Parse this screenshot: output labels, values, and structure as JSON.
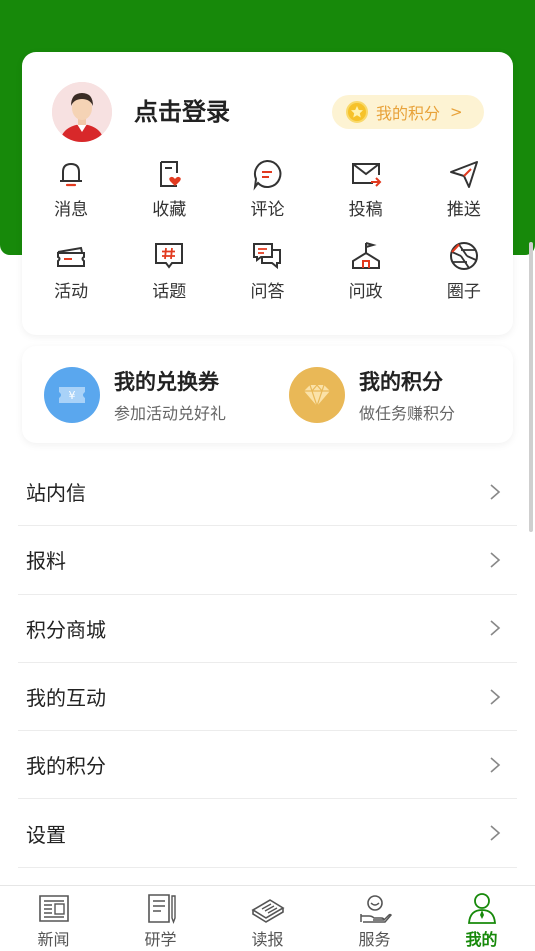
{
  "colors": {
    "brand_green": "#17890a",
    "accent_red": "#e23a1f",
    "gold": "#e8a23a"
  },
  "profile": {
    "login_text": "点击登录",
    "points_pill_label": "我的积分",
    "points_pill_arrow": ">"
  },
  "quick_actions": [
    {
      "label": "消息",
      "icon": "bell-icon"
    },
    {
      "label": "收藏",
      "icon": "favorite-heart-icon"
    },
    {
      "label": "评论",
      "icon": "comment-bubble-icon"
    },
    {
      "label": "投稿",
      "icon": "mail-send-icon"
    },
    {
      "label": "推送",
      "icon": "paper-plane-icon"
    },
    {
      "label": "活动",
      "icon": "ticket-icon"
    },
    {
      "label": "话题",
      "icon": "hashtag-bubble-icon"
    },
    {
      "label": "问答",
      "icon": "qa-bubbles-icon"
    },
    {
      "label": "问政",
      "icon": "government-building-icon"
    },
    {
      "label": "圈子",
      "icon": "aperture-icon"
    }
  ],
  "coupons": {
    "left": {
      "title": "我的兑换券",
      "subtitle": "参加活动兑好礼",
      "icon": "voucher-icon"
    },
    "right": {
      "title": "我的积分",
      "subtitle": "做任务赚积分",
      "icon": "diamond-icon"
    }
  },
  "menu": [
    {
      "label": "站内信"
    },
    {
      "label": "报料"
    },
    {
      "label": "积分商城"
    },
    {
      "label": "我的互动"
    },
    {
      "label": "我的积分"
    },
    {
      "label": "设置"
    }
  ],
  "tabbar": [
    {
      "label": "新闻",
      "icon": "newspaper-icon",
      "active": false
    },
    {
      "label": "研学",
      "icon": "notebook-pen-icon",
      "active": false
    },
    {
      "label": "读报",
      "icon": "folded-paper-icon",
      "active": false
    },
    {
      "label": "服务",
      "icon": "service-hand-icon",
      "active": false
    },
    {
      "label": "我的",
      "icon": "user-profile-icon",
      "active": true
    }
  ]
}
